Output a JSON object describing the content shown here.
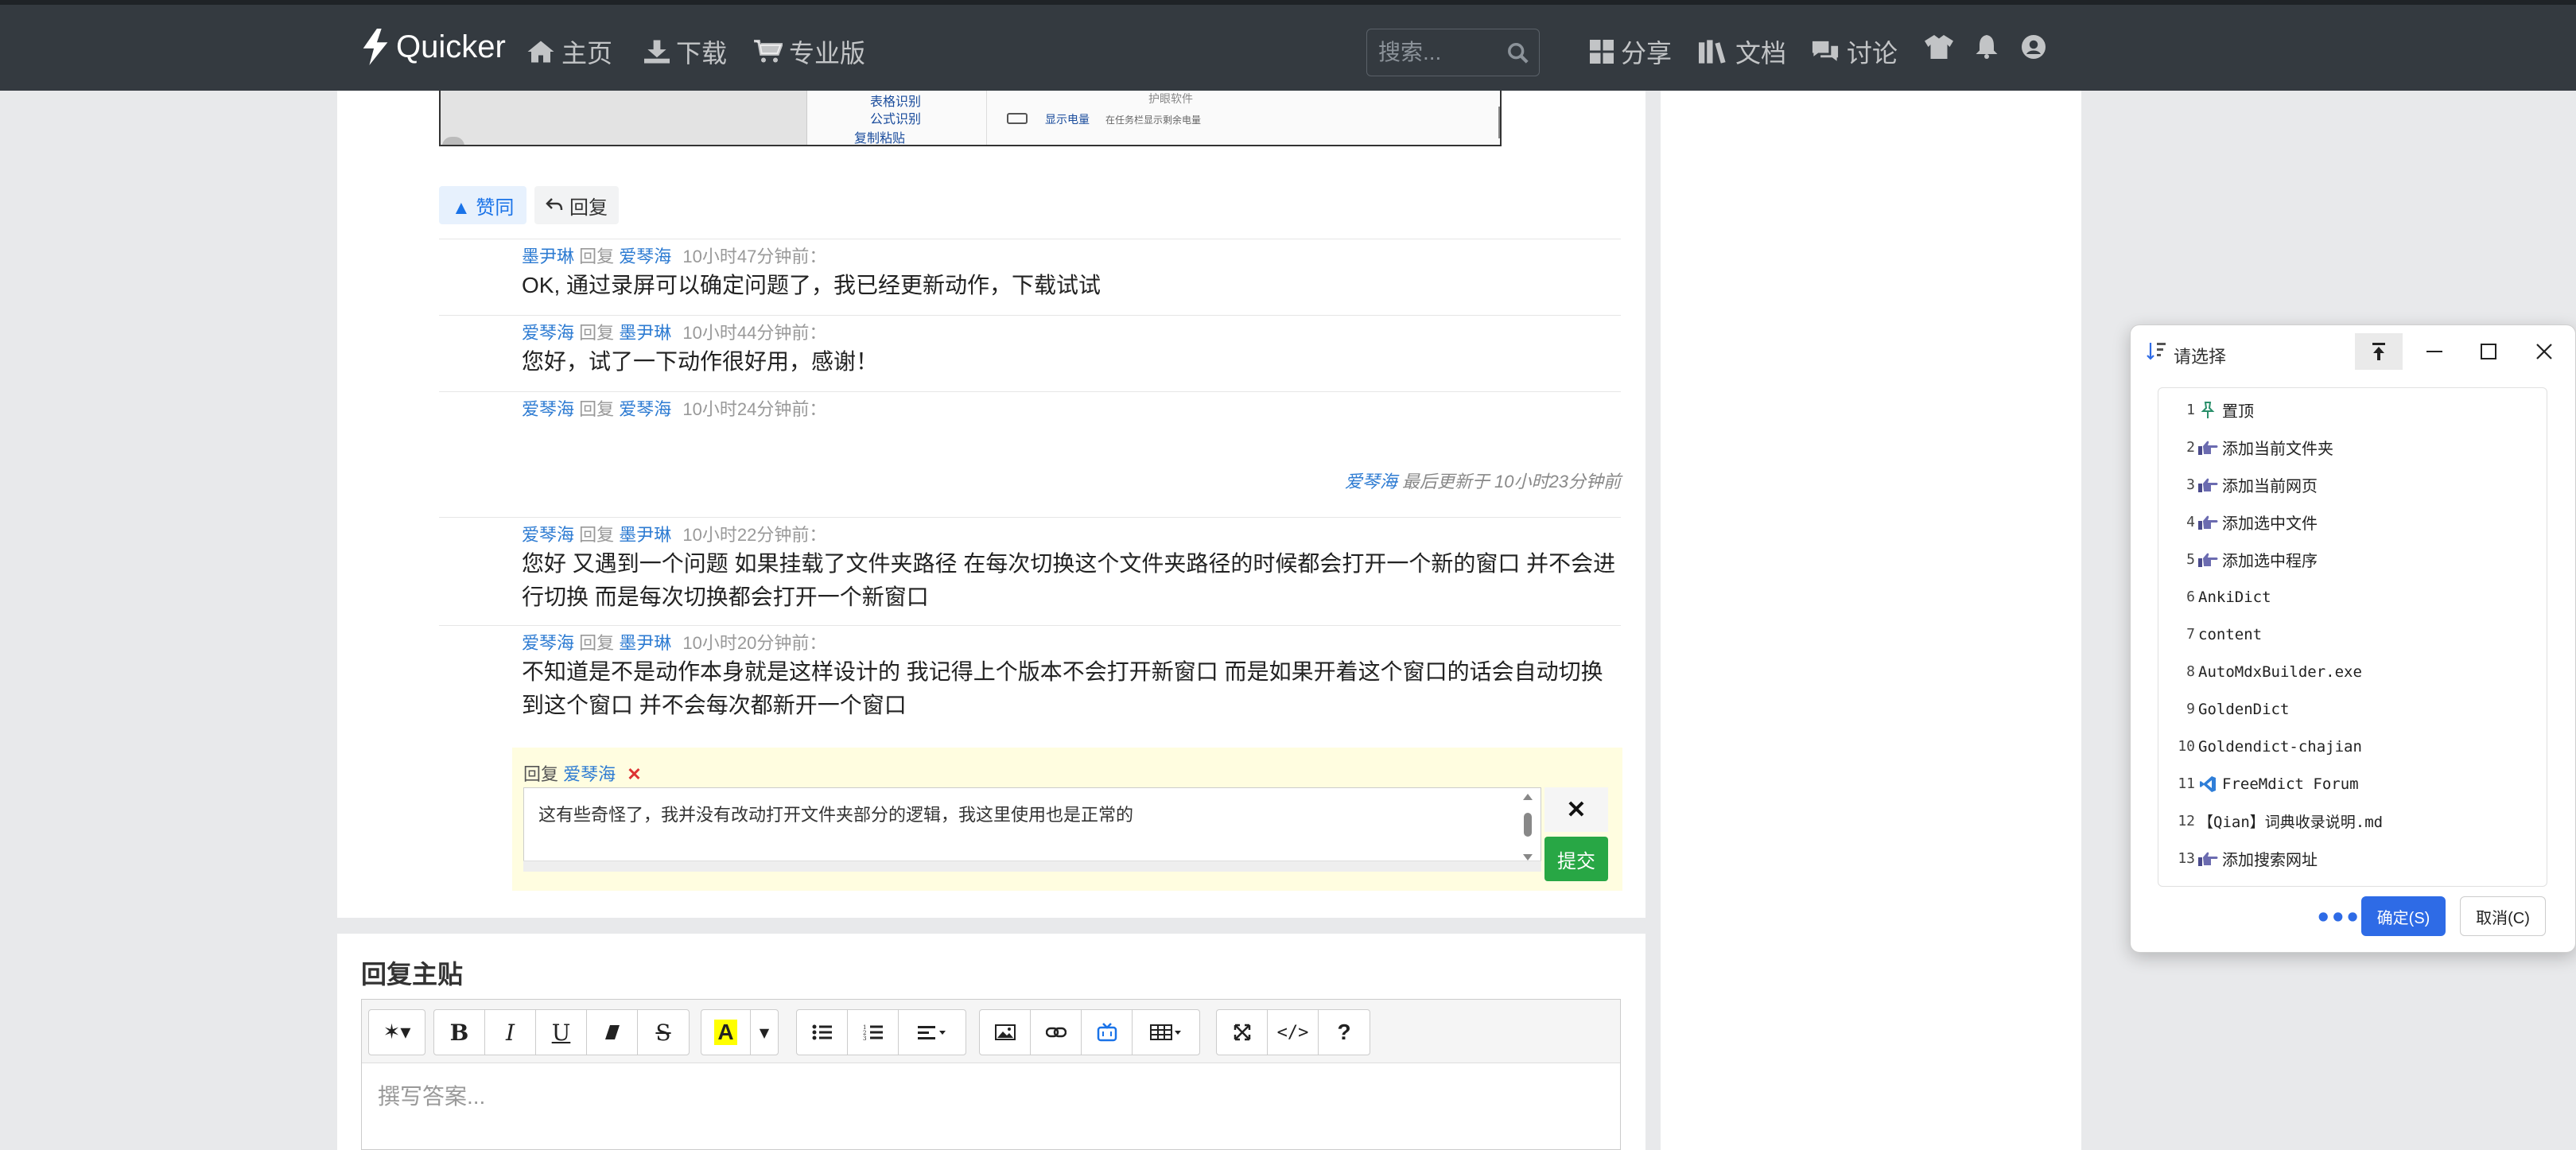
{
  "header": {
    "brand": "Quicker",
    "nav": [
      {
        "label": "主页",
        "icon": "home-icon"
      },
      {
        "label": "下载",
        "icon": "download-icon"
      },
      {
        "label": "专业版",
        "icon": "cart-icon"
      }
    ],
    "search_placeholder": "搜索...",
    "right_nav": [
      {
        "label": "分享",
        "icon": "grid-icon"
      },
      {
        "label": "文档",
        "icon": "books-icon"
      },
      {
        "label": "讨论",
        "icon": "comments-icon"
      }
    ]
  },
  "screenshot": {
    "tree": [
      "表格识别",
      "公式识别",
      "复制粘贴"
    ],
    "right_texts": [
      "护眼软件",
      "显示电量",
      "在任务栏显示剩余电量"
    ]
  },
  "post_actions": {
    "like_label": "▲ 赞同",
    "reply_label": "回复"
  },
  "comments": [
    {
      "author": "墨尹琳",
      "reply_word": "回复",
      "target": "爱琴海",
      "time": "10小时47分钟前：",
      "body": "OK, 通过录屏可以确定问题了，我已经更新动作，下载试试"
    },
    {
      "author": "爱琴海",
      "reply_word": "回复",
      "target": "墨尹琳",
      "time": "10小时44分钟前：",
      "body": "您好，试了一下动作很好用，感谢！"
    },
    {
      "author": "爱琴海",
      "reply_word": "回复",
      "target": "爱琴海",
      "time": "10小时24分钟前：",
      "body": ""
    },
    {
      "author": "爱琴海",
      "reply_word": "回复",
      "target": "墨尹琳",
      "time": "10小时22分钟前：",
      "body": "您好 又遇到一个问题  如果挂载了文件夹路径  在每次切换这个文件夹路径的时候都会打开一个新的窗口  并不会进行切换 而是每次切换都会打开一个新窗口"
    },
    {
      "author": "爱琴海",
      "reply_word": "回复",
      "target": "墨尹琳",
      "time": "10小时20分钟前：",
      "body": "不知道是不是动作本身就是这样设计的  我记得上个版本不会打开新窗口  而是如果开着这个窗口的话会自动切换到这个窗口 并不会每次都新开一个窗口"
    }
  ],
  "last_edit": {
    "user": "爱琴海",
    "text": " 最后更新于 10小时23分钟前"
  },
  "reply_form": {
    "prefix": "回复",
    "target": "爱琴海",
    "close": "✕",
    "text": "这有些奇怪了，我并没有改动打开文件夹部分的逻辑，我这里使用也是正常的",
    "cancel": "✕",
    "submit": "提交"
  },
  "reply_main": {
    "title": "回复主贴",
    "placeholder": "撰写答案..."
  },
  "dialog": {
    "title": "请选择",
    "items": [
      {
        "num": "1",
        "label": "置顶",
        "icon": "pin-icon",
        "mono": false
      },
      {
        "num": "2",
        "label": "添加当前文件夹",
        "icon": "pointing-hand-icon",
        "mono": false
      },
      {
        "num": "3",
        "label": "添加当前网页",
        "icon": "pointing-hand-icon",
        "mono": false
      },
      {
        "num": "4",
        "label": "添加选中文件",
        "icon": "pointing-hand-icon",
        "mono": false
      },
      {
        "num": "5",
        "label": "添加选中程序",
        "icon": "pointing-hand-icon",
        "mono": false
      },
      {
        "num": "6",
        "label": "AnkiDict",
        "icon": "",
        "mono": true
      },
      {
        "num": "7",
        "label": "content",
        "icon": "",
        "mono": true
      },
      {
        "num": "8",
        "label": "AutoMdxBuilder.exe",
        "icon": "",
        "mono": true
      },
      {
        "num": "9",
        "label": "GoldenDict",
        "icon": "",
        "mono": true
      },
      {
        "num": "10",
        "label": "Goldendict-chajian",
        "icon": "",
        "mono": true
      },
      {
        "num": "11",
        "label": "FreeMdict Forum",
        "icon": "vscode-icon",
        "mono": true
      },
      {
        "num": "12",
        "label": "【Qian】词典收录说明.md",
        "icon": "",
        "mono": true
      },
      {
        "num": "13",
        "label": "添加搜索网址",
        "icon": "pointing-hand-icon",
        "mono": false
      }
    ],
    "more": "•••",
    "ok": "确定(S)",
    "cancel": "取消(C)"
  },
  "colors": {
    "accent": "#2e6be6",
    "link": "#2d7bd2",
    "success": "#28a745",
    "header_bg": "#343a40"
  }
}
